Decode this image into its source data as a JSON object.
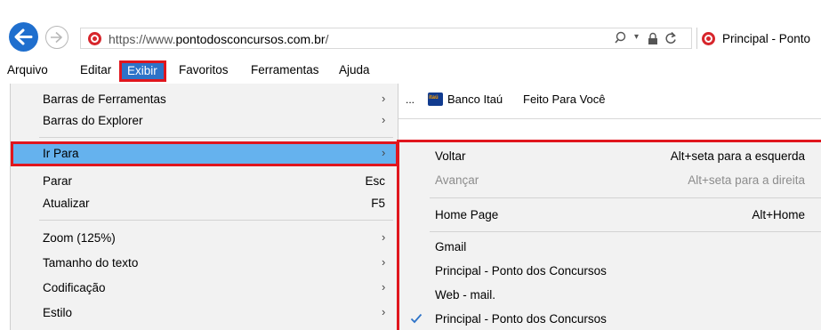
{
  "browser": {
    "url_prefix": "https://www.",
    "url_domain": "pontodosconcursos.com.br",
    "url_suffix": "/",
    "tab_title": "Principal - Ponto",
    "icons": {
      "back": "back-arrow-icon",
      "forward": "forward-arrow-icon",
      "search": "search-icon",
      "lock": "lock-icon",
      "refresh": "refresh-icon"
    },
    "accent_color": "#1f6fce",
    "highlight_border_color": "#e0161e"
  },
  "menubar": {
    "items": [
      "Arquivo",
      "Editar",
      "Exibir",
      "Favoritos",
      "Ferramentas",
      "Ajuda"
    ],
    "active": "Exibir"
  },
  "favorites_bar": {
    "overflow": "...",
    "items": [
      "Banco Itaú",
      "Feito Para Você"
    ],
    "itau_icon_text": "itaú"
  },
  "exibir_menu": {
    "items": [
      {
        "label": "Barras de Ferramentas",
        "submenu": true
      },
      {
        "label": "Barras do Explorer",
        "submenu": true
      },
      {
        "label": "Ir Para",
        "submenu": true,
        "highlighted": true
      },
      {
        "label": "Parar",
        "shortcut": "Esc"
      },
      {
        "label": "Atualizar",
        "shortcut": "F5"
      },
      {
        "label": "Zoom (125%)",
        "submenu": true
      },
      {
        "label": "Tamanho do texto",
        "submenu": true
      },
      {
        "label": "Codificação",
        "submenu": true
      },
      {
        "label": "Estilo",
        "submenu": true
      }
    ],
    "arrow_glyph": "›"
  },
  "irpara_menu": {
    "items": [
      {
        "label": "Voltar",
        "shortcut": "Alt+seta para a esquerda"
      },
      {
        "label": "Avançar",
        "shortcut": "Alt+seta para a direita",
        "disabled": true
      },
      {
        "label": "Home Page",
        "shortcut": "Alt+Home"
      },
      {
        "label": "Gmail"
      },
      {
        "label": "Principal - Ponto dos Concursos"
      },
      {
        "label": "Web - mail."
      },
      {
        "label": "Principal - Ponto dos Concursos",
        "checked": true
      }
    ]
  }
}
